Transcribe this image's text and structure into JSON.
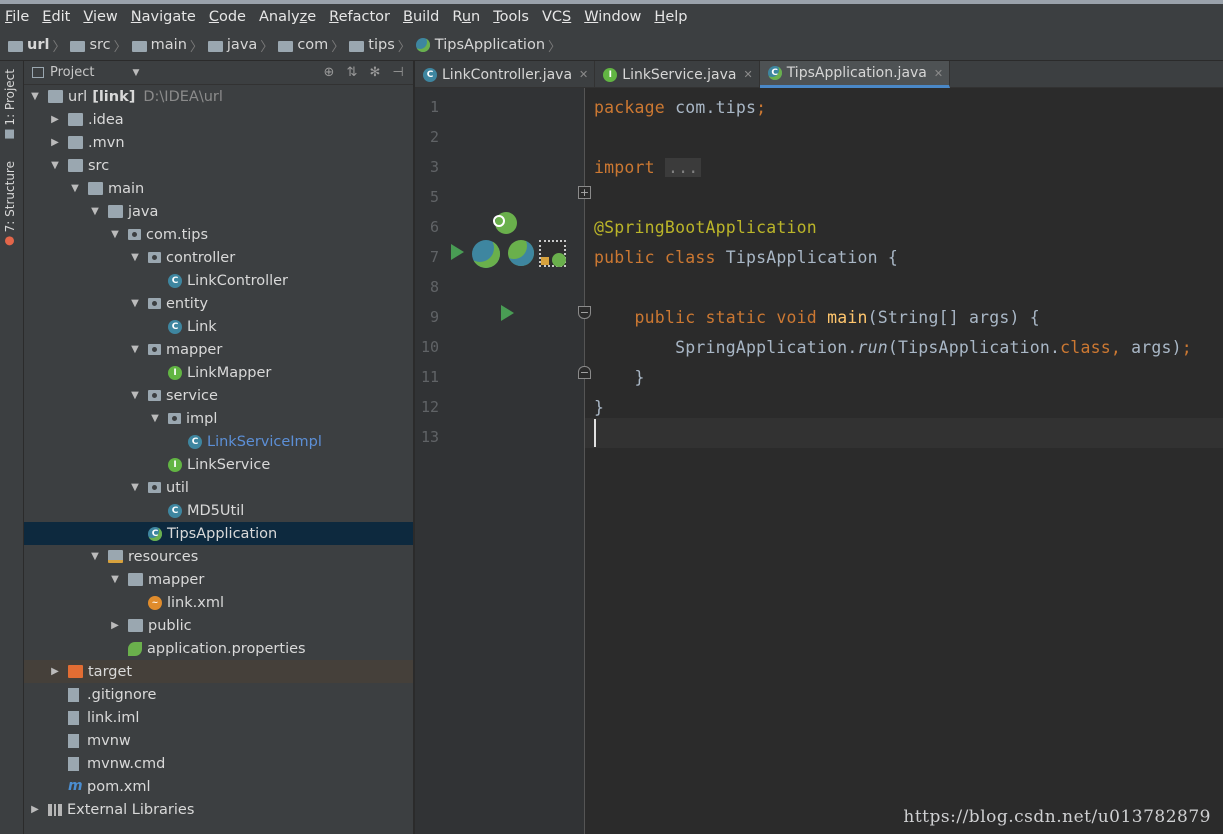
{
  "menu": [
    {
      "u": "F",
      "rest": "ile"
    },
    {
      "u": "E",
      "rest": "dit"
    },
    {
      "u": "V",
      "rest": "iew"
    },
    {
      "u": "N",
      "rest": "avigate"
    },
    {
      "u": "C",
      "rest": "ode"
    },
    {
      "pre": "Analy",
      "u": "z",
      "rest": "e"
    },
    {
      "u": "R",
      "rest": "efactor"
    },
    {
      "u": "B",
      "rest": "uild"
    },
    {
      "pre": "R",
      "u": "u",
      "rest": "n"
    },
    {
      "u": "T",
      "rest": "ools"
    },
    {
      "pre": "VC",
      "u": "S",
      "rest": ""
    },
    {
      "u": "W",
      "rest": "indow"
    },
    {
      "u": "H",
      "rest": "elp"
    }
  ],
  "breadcrumb": [
    "url",
    "src",
    "main",
    "java",
    "com",
    "tips",
    "TipsApplication"
  ],
  "sidebar_tabs": {
    "project": "1: Project",
    "structure": "7: Structure"
  },
  "project_panel": {
    "title": "Project"
  },
  "tree": [
    {
      "depth": 0,
      "twisty": "open",
      "icon": "folder",
      "label": "url",
      "suffix": "[link]",
      "path": "D:\\IDEA\\url"
    },
    {
      "depth": 1,
      "twisty": "closed",
      "icon": "folder",
      "label": ".idea"
    },
    {
      "depth": 1,
      "twisty": "closed",
      "icon": "folder",
      "label": ".mvn"
    },
    {
      "depth": 1,
      "twisty": "open",
      "icon": "folder",
      "label": "src"
    },
    {
      "depth": 2,
      "twisty": "open",
      "icon": "folder",
      "label": "main"
    },
    {
      "depth": 3,
      "twisty": "open",
      "icon": "folder-src",
      "label": "java"
    },
    {
      "depth": 4,
      "twisty": "open",
      "icon": "pkg",
      "label": "com.tips"
    },
    {
      "depth": 5,
      "twisty": "open",
      "icon": "pkg",
      "label": "controller"
    },
    {
      "depth": 6,
      "twisty": "none",
      "icon": "cls",
      "label": "LinkController"
    },
    {
      "depth": 5,
      "twisty": "open",
      "icon": "pkg",
      "label": "entity"
    },
    {
      "depth": 6,
      "twisty": "none",
      "icon": "cls",
      "label": "Link"
    },
    {
      "depth": 5,
      "twisty": "open",
      "icon": "pkg",
      "label": "mapper"
    },
    {
      "depth": 6,
      "twisty": "none",
      "icon": "intf",
      "label": "LinkMapper"
    },
    {
      "depth": 5,
      "twisty": "open",
      "icon": "pkg",
      "label": "service"
    },
    {
      "depth": 6,
      "twisty": "open",
      "icon": "pkg",
      "label": "impl"
    },
    {
      "depth": 7,
      "twisty": "none",
      "icon": "cls",
      "label": "LinkServiceImpl",
      "style": "link"
    },
    {
      "depth": 6,
      "twisty": "none",
      "icon": "intf",
      "label": "LinkService"
    },
    {
      "depth": 5,
      "twisty": "open",
      "icon": "pkg",
      "label": "util"
    },
    {
      "depth": 6,
      "twisty": "none",
      "icon": "cls",
      "label": "MD5Util"
    },
    {
      "depth": 5,
      "twisty": "none",
      "icon": "spring",
      "label": "TipsApplication",
      "selected": true
    },
    {
      "depth": 3,
      "twisty": "open",
      "icon": "folder-res",
      "label": "resources"
    },
    {
      "depth": 4,
      "twisty": "open",
      "icon": "folder",
      "label": "mapper"
    },
    {
      "depth": 5,
      "twisty": "none",
      "icon": "xml",
      "label": "link.xml"
    },
    {
      "depth": 4,
      "twisty": "closed",
      "icon": "folder",
      "label": "public"
    },
    {
      "depth": 4,
      "twisty": "none",
      "icon": "props",
      "label": "application.properties"
    },
    {
      "depth": 1,
      "twisty": "closed",
      "icon": "folder-tgt",
      "label": "target",
      "highlight": true
    },
    {
      "depth": 1,
      "twisty": "none",
      "icon": "file",
      "label": ".gitignore"
    },
    {
      "depth": 1,
      "twisty": "none",
      "icon": "file",
      "label": "link.iml"
    },
    {
      "depth": 1,
      "twisty": "none",
      "icon": "file",
      "label": "mvnw"
    },
    {
      "depth": 1,
      "twisty": "none",
      "icon": "file",
      "label": "mvnw.cmd"
    },
    {
      "depth": 1,
      "twisty": "none",
      "icon": "maven",
      "label": "pom.xml"
    },
    {
      "depth": 0,
      "twisty": "closed",
      "icon": "libs",
      "label": "External Libraries"
    }
  ],
  "tabs": [
    {
      "label": "LinkController.java",
      "icon": "cls",
      "active": false
    },
    {
      "label": "LinkService.java",
      "icon": "intf",
      "active": false
    },
    {
      "label": "TipsApplication.java",
      "icon": "spring",
      "active": true
    }
  ],
  "line_numbers": [
    "1",
    "2",
    "3",
    "5",
    "6",
    "7",
    "8",
    "9",
    "10",
    "11",
    "12",
    "13"
  ],
  "code_lines": [
    [
      {
        "t": "package ",
        "c": "kw"
      },
      {
        "t": "com.tips"
      },
      {
        "t": ";",
        "c": "kw"
      }
    ],
    [],
    [
      {
        "t": "import ",
        "c": "kw"
      },
      {
        "t": "...",
        "c": "fold-box"
      }
    ],
    [],
    [
      {
        "t": "@SpringBootApplication",
        "c": "ann"
      }
    ],
    [
      {
        "t": "public class ",
        "c": "kw"
      },
      {
        "t": "TipsApplication {"
      }
    ],
    [],
    [
      {
        "t": "    public static void ",
        "c": "kw"
      },
      {
        "t": "main",
        "c": "fn"
      },
      {
        "t": "(String[] args) {"
      }
    ],
    [
      {
        "t": "        SpringApplication."
      },
      {
        "t": "run",
        "c": "it"
      },
      {
        "t": "(TipsApplication."
      },
      {
        "t": "class",
        "c": "kw"
      },
      {
        "t": ", ",
        "c": "kw"
      },
      {
        "t": "args)"
      },
      {
        "t": ";",
        "c": "kw"
      }
    ],
    [
      {
        "t": "    }"
      }
    ],
    [
      {
        "t": "}"
      }
    ],
    []
  ],
  "watermark": "https://blog.csdn.net/u013782879",
  "colors": {
    "accent": "#4a88c7",
    "selection": "#0d293e",
    "keyword": "#cc7832",
    "annotation": "#bbb529",
    "method": "#ffc66d",
    "run": "#499c54"
  }
}
